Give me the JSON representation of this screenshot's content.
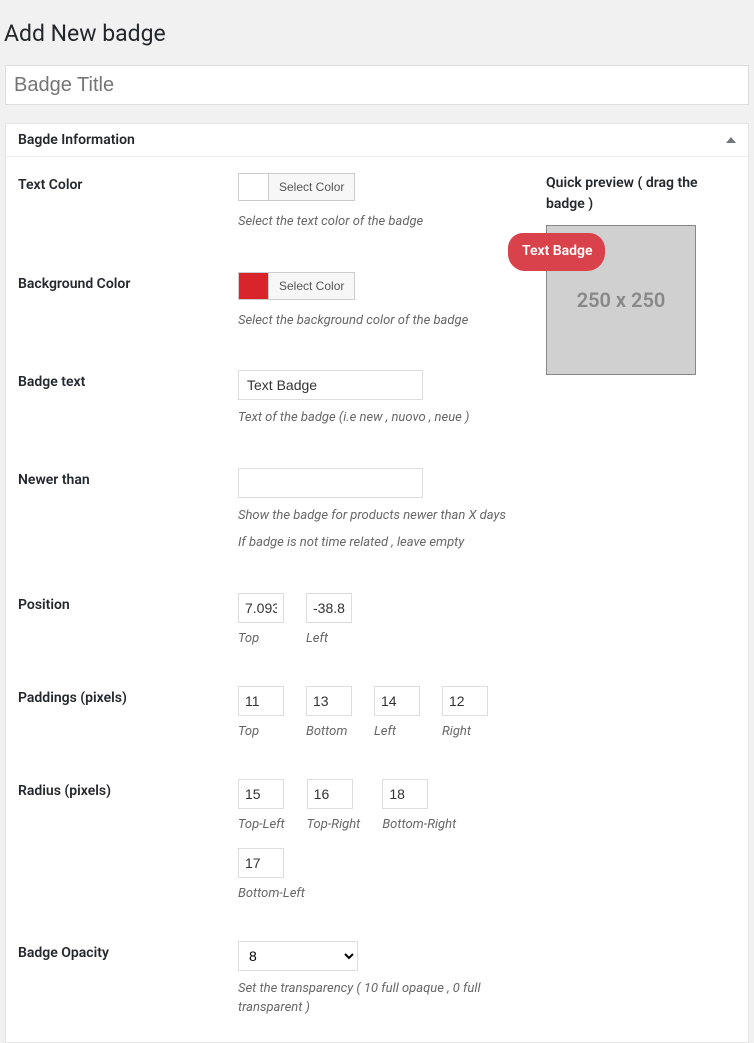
{
  "page": {
    "title": "Add New badge"
  },
  "title_input": {
    "value": "",
    "placeholder": "Badge Title"
  },
  "metabox": {
    "title": "Bagde Information"
  },
  "preview": {
    "label": "Quick preview ( drag the badge )",
    "placeholder": "250 x 250",
    "badge_text": "Text Badge"
  },
  "fields": {
    "text_color": {
      "label": "Text Color",
      "button": "Select Color",
      "desc": "Select the text color of the badge"
    },
    "bg_color": {
      "label": "Background Color",
      "button": "Select Color",
      "desc": "Select the background color of the badge"
    },
    "badge_text": {
      "label": "Badge text",
      "value": "Text Badge",
      "desc": "Text of the badge (i.e new , nuovo , neue )"
    },
    "newer_than": {
      "label": "Newer than",
      "value": "",
      "desc1": "Show the badge for products newer than X days",
      "desc2": "If badge is not time related , leave empty"
    },
    "position": {
      "label": "Position",
      "top_value": "7.093",
      "top_label": "Top",
      "left_value": "-38.8",
      "left_label": "Left"
    },
    "paddings": {
      "label": "Paddings (pixels)",
      "top_value": "11",
      "top_label": "Top",
      "bottom_value": "13",
      "bottom_label": "Bottom",
      "left_value": "14",
      "left_label": "Left",
      "right_value": "12",
      "right_label": "Right"
    },
    "radius": {
      "label": "Radius (pixels)",
      "tl_value": "15",
      "tl_label": "Top-Left",
      "tr_value": "16",
      "tr_label": "Top-Right",
      "br_value": "18",
      "br_label": "Bottom-Right",
      "bl_value": "17",
      "bl_label": "Bottom-Left"
    },
    "opacity": {
      "label": "Badge Opacity",
      "value": "8",
      "desc": "Set the transparency ( 10 full opaque , 0 full transparent )"
    }
  }
}
